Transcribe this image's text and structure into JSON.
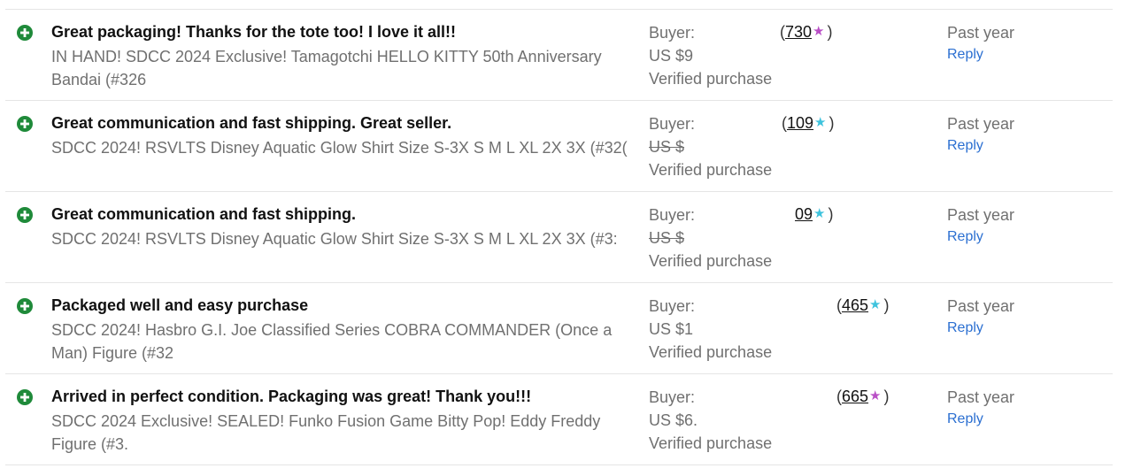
{
  "colors": {
    "icon_green": "#1f8a3a",
    "star_purple": "#b94fc6",
    "star_teal": "#3ec3dd",
    "reply_blue": "#2b6fd1"
  },
  "rows": [
    {
      "icon": "plus-circle-icon",
      "title": "Great packaging! Thanks for the tote too! I love it all!!",
      "item": "IN HAND! SDCC 2024 Exclusive! Tamagotchi HELLO KITTY 50th Anniversary Bandai (#326",
      "buyer_label": "Buyer:",
      "price": "US $9",
      "price_struck": false,
      "verified": "Verified purchase",
      "score_open": "(",
      "score": "730",
      "score_close": ")",
      "star": "★",
      "star_color": "#b94fc6",
      "when": "Past year",
      "reply": "Reply"
    },
    {
      "icon": "plus-circle-icon",
      "title": "Great communication and fast shipping. Great seller.",
      "item": "SDCC 2024! RSVLTS Disney Aquatic Glow Shirt Size S-3X S M L XL 2X 3X (#32(",
      "buyer_label": "Buyer:",
      "price": "US $",
      "price_struck": true,
      "verified": "Verified purchase",
      "score_open": "(",
      "score": "109",
      "score_close": ")",
      "star": "★",
      "star_color": "#3ec3dd",
      "when": "Past year",
      "reply": "Reply"
    },
    {
      "icon": "plus-circle-icon",
      "title": "Great communication and fast shipping.",
      "item": "SDCC 2024! RSVLTS Disney Aquatic Glow Shirt Size S-3X S M L XL 2X 3X (#3:",
      "buyer_label": "Buyer:",
      "price": "US $",
      "price_struck": true,
      "verified": "Verified purchase",
      "score_open": "",
      "score": "09",
      "score_close": ")",
      "star": "★",
      "star_color": "#3ec3dd",
      "when": "Past year",
      "reply": "Reply"
    },
    {
      "icon": "plus-circle-icon",
      "title": "Packaged well and easy purchase",
      "item": "SDCC 2024! Hasbro G.I. Joe Classified Series COBRA COMMANDER (Once a Man) Figure (#32",
      "buyer_label": "Buyer:",
      "price": "US $1",
      "price_struck": false,
      "verified": "Verified purchase",
      "score_open": "(",
      "score": "465",
      "score_close": ")",
      "star": "★",
      "star_color": "#3ec3dd",
      "when": "Past year",
      "reply": "Reply"
    },
    {
      "icon": "plus-circle-icon",
      "title": "Arrived in perfect condition. Packaging was great! Thank you!!!",
      "item": "SDCC 2024 Exclusive! SEALED! Funko Fusion Game Bitty Pop! Eddy Freddy Figure (#3.",
      "buyer_label": "Buyer:",
      "price": "US $6.",
      "price_struck": false,
      "verified": "Verified purchase",
      "score_open": "(",
      "score": "665",
      "score_close": ")",
      "star": "★",
      "star_color": "#b94fc6",
      "when": "Past year",
      "reply": "Reply"
    }
  ]
}
